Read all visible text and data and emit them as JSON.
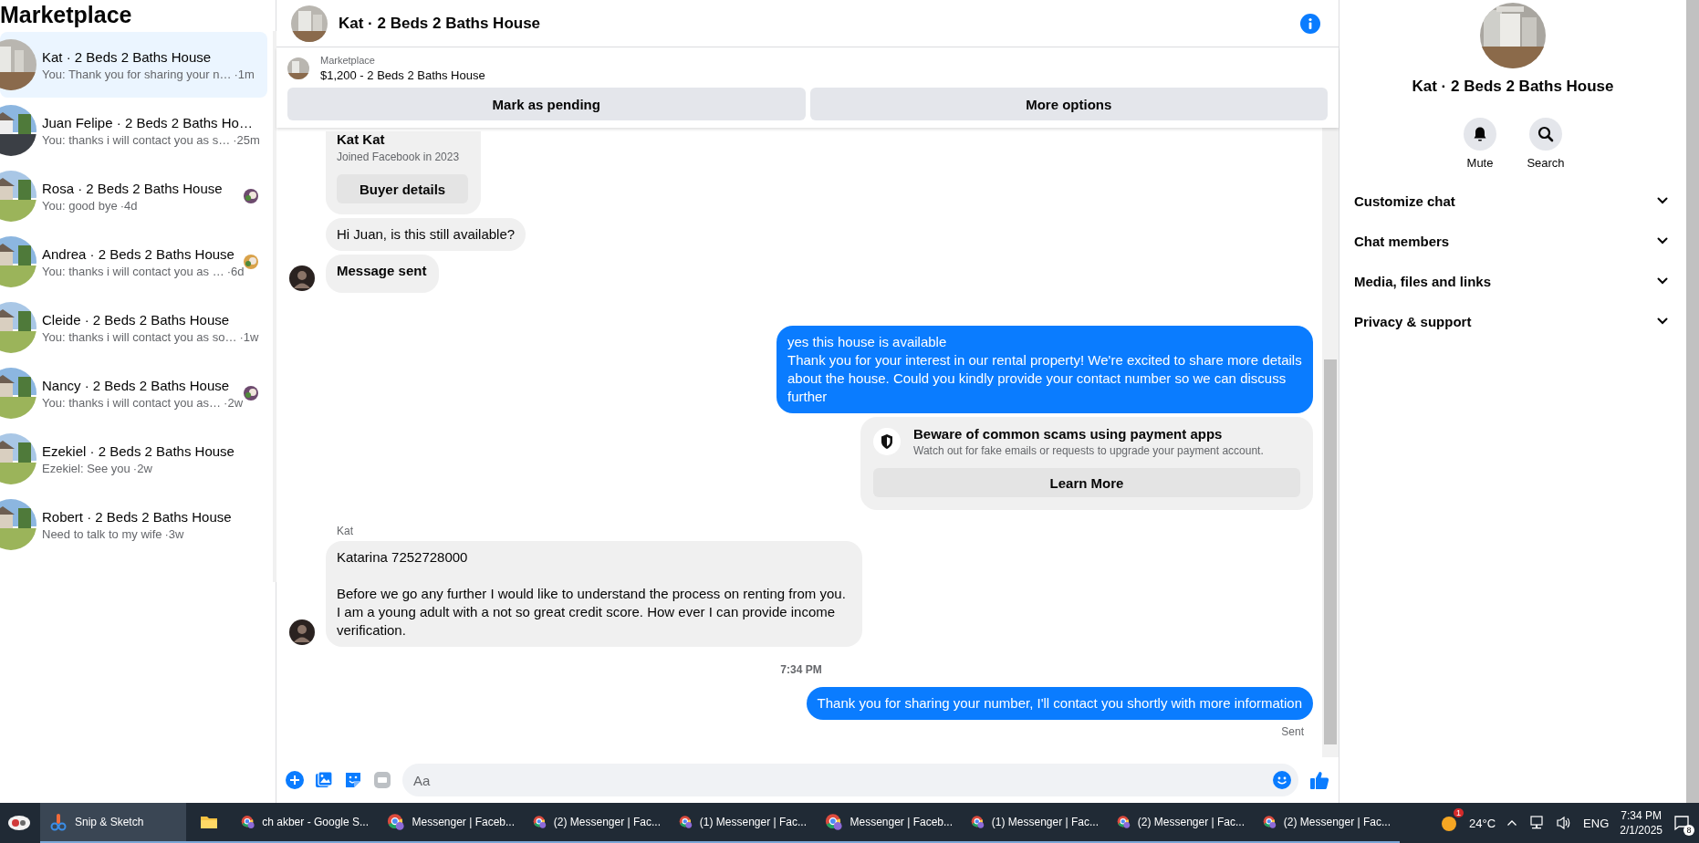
{
  "sidebar": {
    "title": "Marketplace",
    "conversations": [
      {
        "name": "Kat · 2 Beds 2 Baths House",
        "preview": "You: Thank you for sharing your n…",
        "time": "·1m",
        "selected": true,
        "seen_avatar": false
      },
      {
        "name": "Juan Felipe · 2 Beds 2 Baths Ho…",
        "preview": "You: thanks i will contact you as s…",
        "time": "·25m",
        "selected": false,
        "seen_avatar": false
      },
      {
        "name": "Rosa · 2 Beds 2 Baths House",
        "preview": "You: good bye",
        "time": "·4d",
        "selected": false,
        "seen_avatar": true
      },
      {
        "name": "Andrea · 2 Beds 2 Baths House",
        "preview": "You: thanks i will contact you as …",
        "time": "·6d",
        "selected": false,
        "seen_avatar": true
      },
      {
        "name": "Cleide · 2 Beds 2 Baths House",
        "preview": "You: thanks i will contact you as so…",
        "time": "·1w",
        "selected": false,
        "seen_avatar": false
      },
      {
        "name": "Nancy · 2 Beds 2 Baths House",
        "preview": "You: thanks i will contact you as…",
        "time": "·2w",
        "selected": false,
        "seen_avatar": true
      },
      {
        "name": "Ezekiel · 2 Beds 2 Baths House",
        "preview": "Ezekiel: See you",
        "time": "·2w",
        "selected": false,
        "seen_avatar": false
      },
      {
        "name": "Robert · 2 Beds 2 Baths House",
        "preview": "Need to talk to my wife",
        "time": "·3w",
        "selected": false,
        "seen_avatar": false
      }
    ]
  },
  "chat": {
    "title": "Kat · 2 Beds 2 Baths House",
    "listing": {
      "source": "Marketplace",
      "title": "$1,200 - 2 Beds 2 Baths House",
      "buttons": [
        "Mark as pending",
        "More options"
      ]
    },
    "messages": [
      {
        "kind": "buyer_card",
        "name": "Kat Kat",
        "subtitle": "Joined Facebook in 2023",
        "button": "Buyer details"
      },
      {
        "kind": "incoming",
        "text": "Hi Juan, is this still available?",
        "avatar": false
      },
      {
        "kind": "system",
        "text": "Message sent",
        "avatar": true
      },
      {
        "kind": "outgoing",
        "text": "yes this house is available\nThank you for your interest in our rental property! We're excited to share more details about the house. Could you kindly provide your contact number so we can discuss further"
      },
      {
        "kind": "notice",
        "title": "Beware of common scams using payment apps",
        "text": "Watch out for fake emails or requests to upgrade your payment account.",
        "button": "Learn More"
      },
      {
        "kind": "sender",
        "text": "Kat"
      },
      {
        "kind": "incoming",
        "text": "Katarina 7252728000\n\nBefore we go any further I would like to understand the process on renting from you. I am a young adult with a not so great credit score. How ever I can provide income verification.",
        "avatar": true
      },
      {
        "kind": "time",
        "text": "7:34 PM"
      },
      {
        "kind": "outgoing",
        "text": "Thank you for sharing your number, I'll contact you shortly with more information"
      },
      {
        "kind": "receipt",
        "text": "Sent"
      }
    ],
    "composer": {
      "placeholder": "Aa"
    }
  },
  "details": {
    "title": "Kat · 2 Beds 2 Baths House",
    "actions": [
      {
        "label": "Mute"
      },
      {
        "label": "Search"
      }
    ],
    "sections": [
      {
        "label": "Customize chat",
        "expanded": false
      },
      {
        "label": "Chat members",
        "expanded": false
      },
      {
        "label": "Media, files and links",
        "expanded": false
      },
      {
        "label": "Privacy & support",
        "expanded": false
      }
    ]
  },
  "taskbar": {
    "apps": [
      {
        "label": "Snip & Sketch",
        "kind": "snip",
        "selected": true
      },
      {
        "kind": "folder",
        "selected": false
      },
      {
        "label": "ch akber - Google S...",
        "kind": "browser",
        "selected": false
      },
      {
        "label": "Messenger | Faceb...",
        "kind": "browser",
        "selected": false
      },
      {
        "label": "(2) Messenger | Fac...",
        "kind": "browser",
        "selected": false
      },
      {
        "label": "(1) Messenger | Fac...",
        "kind": "browser",
        "selected": false
      },
      {
        "label": "Messenger | Faceb...",
        "kind": "browser",
        "selected": false
      },
      {
        "label": "(1) Messenger | Fac...",
        "kind": "browser",
        "selected": false
      },
      {
        "label": "(2) Messenger | Fac...",
        "kind": "browser",
        "selected": false
      },
      {
        "label": "(2) Messenger | Fac...",
        "kind": "browser",
        "selected": false
      }
    ],
    "weather_badge": "1",
    "temperature": "24°C",
    "language": "ENG",
    "time": "7:34 PM",
    "date": "2/1/2025",
    "notifications": "8"
  }
}
